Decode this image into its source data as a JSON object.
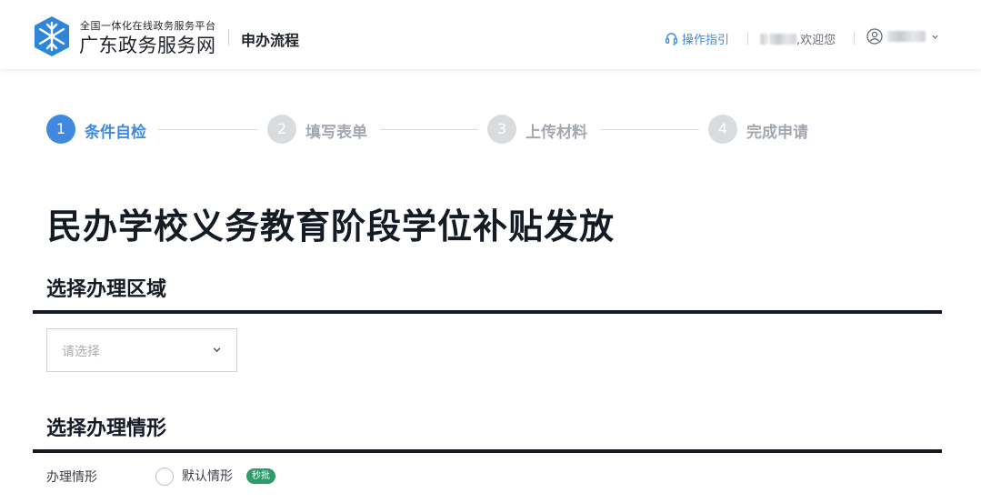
{
  "header": {
    "logo_subtitle": "全国一体化在线政务服务平台",
    "logo_title": "广东政务服务网",
    "section_title": "申办流程",
    "guide_label": "操作指引",
    "welcome_text": ",欢迎您"
  },
  "steps": [
    {
      "number": "1",
      "label": "条件自检",
      "active": true
    },
    {
      "number": "2",
      "label": "填写表单",
      "active": false
    },
    {
      "number": "3",
      "label": "上传材料",
      "active": false
    },
    {
      "number": "4",
      "label": "完成申请",
      "active": false
    }
  ],
  "page_title": "民办学校义务教育阶段学位补贴发放",
  "region_section": {
    "title": "选择办理区域",
    "select_placeholder": "请选择"
  },
  "situation_section": {
    "title": "选择办理情形",
    "row_label": "办理情形",
    "option_label": "默认情形",
    "badge": "秒批"
  },
  "colors": {
    "accent": "#3f8ae0",
    "step_inactive": "#d9dcdf",
    "step_inactive_text": "#a3a8ae",
    "badge": "#2e9b6c",
    "rule": "#141b25"
  },
  "icons": {
    "logo": "snowflake-logo-icon",
    "guide": "headset-icon",
    "user": "user-circle-icon",
    "dropdown": "chevron-down-icon"
  }
}
